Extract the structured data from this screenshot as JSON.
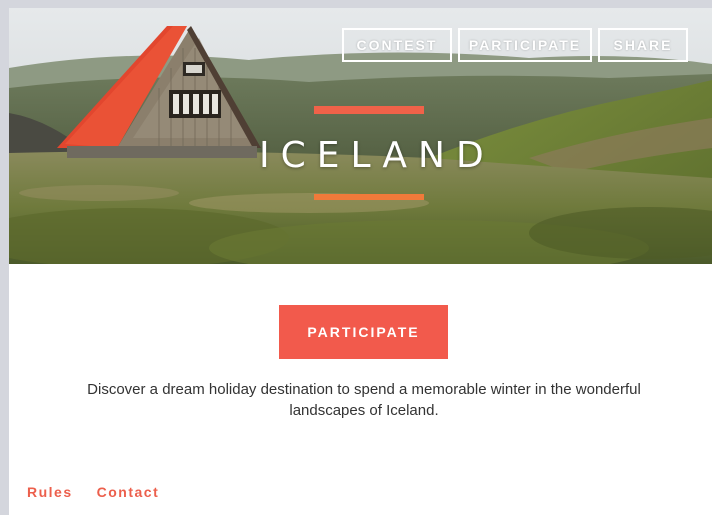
{
  "nav": {
    "items": [
      {
        "label": "CONTEST"
      },
      {
        "label": "PARTICIPATE"
      },
      {
        "label": "SHARE"
      }
    ]
  },
  "hero": {
    "title": "ICELAND",
    "image": "mountain-hut-landscape",
    "accent_color": "#f06249"
  },
  "main": {
    "cta_label": "PARTICIPATE",
    "cta_color": "#f25a4c",
    "description": "Discover a dream holiday destination to spend a memorable winter in the wonderful landscapes of Iceland."
  },
  "footer": {
    "links": [
      {
        "label": "Rules"
      },
      {
        "label": "Contact"
      }
    ],
    "link_color": "#ec5f4c"
  }
}
